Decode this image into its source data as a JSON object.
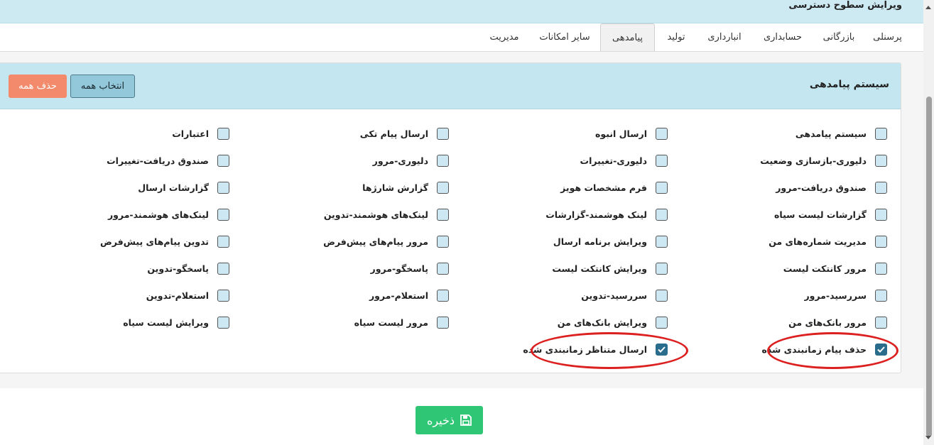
{
  "page": {
    "title": "ویرایش سطوح دسترسی"
  },
  "tabs": [
    {
      "label": "پرسنلی",
      "active": false
    },
    {
      "label": "بازرگانی",
      "active": false
    },
    {
      "label": "حسابداری",
      "active": false
    },
    {
      "label": "انبارداری",
      "active": false
    },
    {
      "label": "تولید",
      "active": false
    },
    {
      "label": "پیامدهی",
      "active": true
    },
    {
      "label": "سایر امکانات",
      "active": false
    },
    {
      "label": "مدیریت",
      "active": false
    }
  ],
  "panel": {
    "title": "سیستم پیامدهی",
    "select_all_label": "انتخاب همه",
    "delete_all_label": "حذف همه"
  },
  "permissions": [
    {
      "label": "سیستم پیامدهی",
      "checked": false
    },
    {
      "label": "ارسال انبوه",
      "checked": false
    },
    {
      "label": "ارسال پیام تکی",
      "checked": false
    },
    {
      "label": "اعتبارات",
      "checked": false
    },
    {
      "label": "دلیوری-بازسازی وضعیت",
      "checked": false
    },
    {
      "label": "دلیوری-تغییرات",
      "checked": false
    },
    {
      "label": "دلیوری-مرور",
      "checked": false
    },
    {
      "label": "صندوق دریافت-تغییرات",
      "checked": false
    },
    {
      "label": "صندوق دریافت-مرور",
      "checked": false
    },
    {
      "label": "فرم مشخصات هویز",
      "checked": false
    },
    {
      "label": "گزارش شارژها",
      "checked": false
    },
    {
      "label": "گزارشات ارسال",
      "checked": false
    },
    {
      "label": "گزارشات لیست سیاه",
      "checked": false
    },
    {
      "label": "لینک هوشمند-گزارشات",
      "checked": false
    },
    {
      "label": "لینک‌های هوشمند-تدوین",
      "checked": false
    },
    {
      "label": "لینک‌های هوشمند-مرور",
      "checked": false
    },
    {
      "label": "مدیریت شماره‌های من",
      "checked": false
    },
    {
      "label": "ویرایش برنامه ارسال",
      "checked": false
    },
    {
      "label": "مرور پیام‌های پیش‌فرض",
      "checked": false
    },
    {
      "label": "تدوین پیام‌های پیش‌فرض",
      "checked": false
    },
    {
      "label": "مرور کانتکت لیست",
      "checked": false
    },
    {
      "label": "ویرایش کانتکت لیست",
      "checked": false
    },
    {
      "label": "پاسخگو-مرور",
      "checked": false
    },
    {
      "label": "پاسخگو-تدوین",
      "checked": false
    },
    {
      "label": "سررسید-مرور",
      "checked": false
    },
    {
      "label": "سررسید-تدوین",
      "checked": false
    },
    {
      "label": "استعلام-مرور",
      "checked": false
    },
    {
      "label": "استعلام-تدوین",
      "checked": false
    },
    {
      "label": "مرور بانک‌های من",
      "checked": false
    },
    {
      "label": "ویرایش بانک‌های من",
      "checked": false
    },
    {
      "label": "مرور لیست سیاه",
      "checked": false
    },
    {
      "label": "ویرایش لیست سیاه",
      "checked": false
    },
    {
      "label": "حذف پیام زمانبندی شده",
      "checked": true
    },
    {
      "label": "ارسال متناظر زمانبندی شده",
      "checked": true
    }
  ],
  "save": {
    "label": "ذخیره",
    "icon": "floppy-disk-icon"
  },
  "colors": {
    "header_bg": "#cdeaf3",
    "panel_header_bg": "#c4e6f0",
    "select_all_bg": "#93c8da",
    "delete_all_bg": "#f28a6b",
    "save_bg": "#2fc775",
    "checkbox_checked": "#2a6c8c",
    "highlight": "#dc1f1f"
  }
}
